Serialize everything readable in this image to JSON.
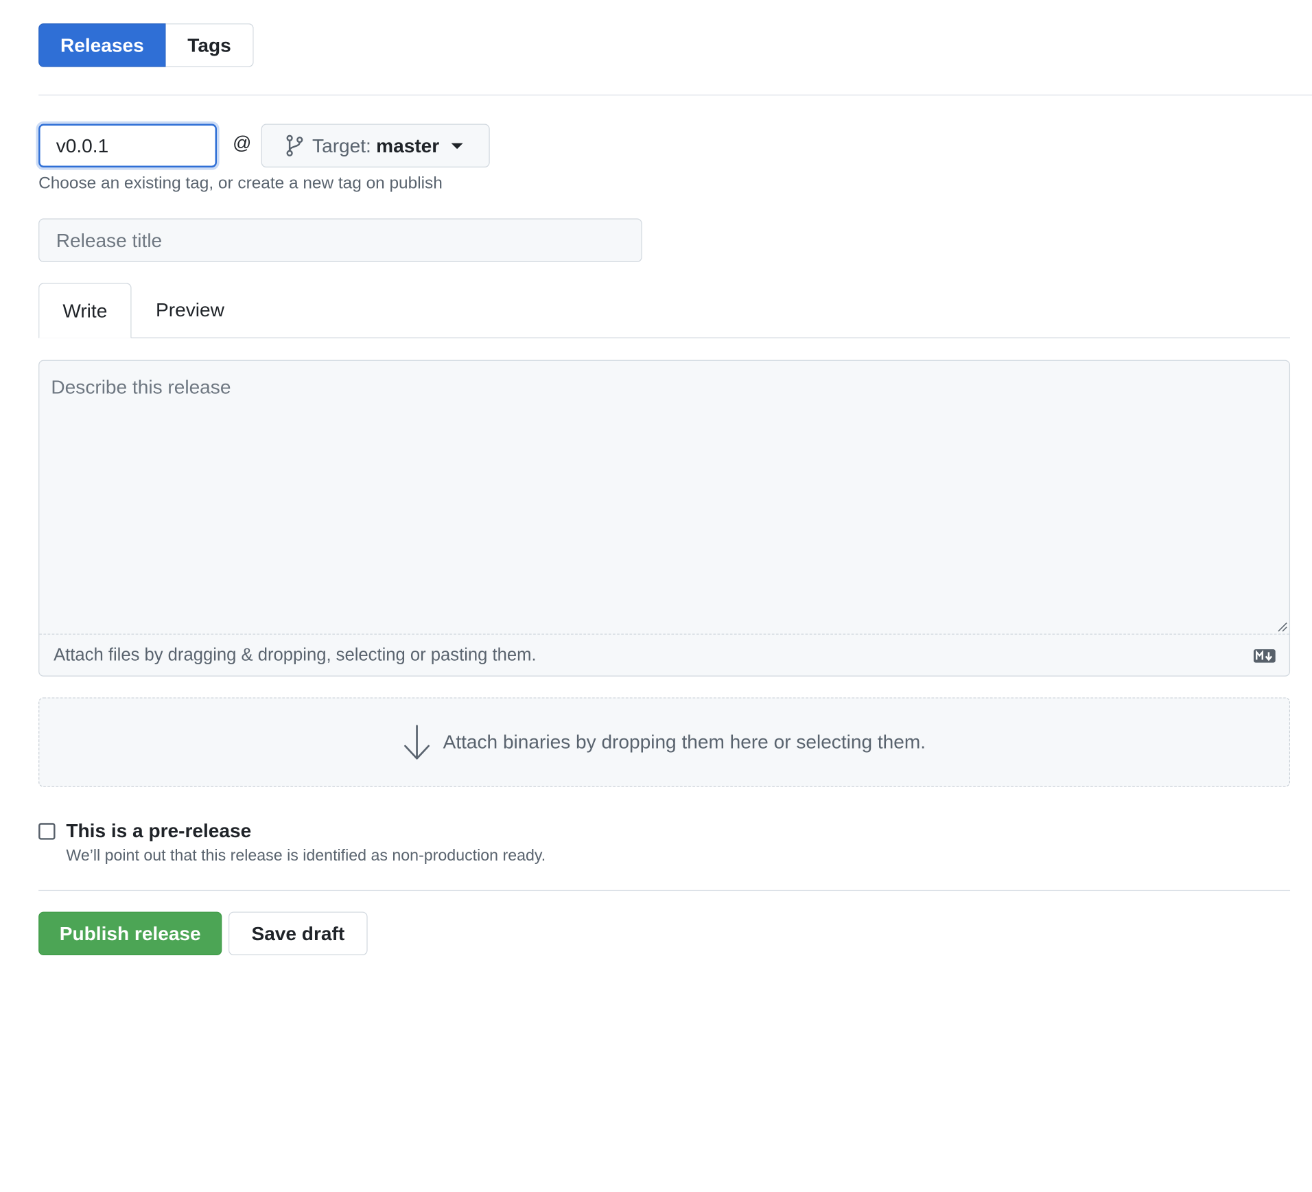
{
  "segmented": {
    "releases_label": "Releases",
    "tags_label": "Tags",
    "active": "Releases"
  },
  "tag": {
    "value": "v0.0.1",
    "at_symbol": "@",
    "target_prefix": "Target:",
    "target_branch": "master",
    "help_text": "Choose an existing tag, or create a new tag on publish"
  },
  "title": {
    "placeholder": "Release title"
  },
  "editor": {
    "tabs": [
      {
        "label": "Write",
        "active": true
      },
      {
        "label": "Preview",
        "active": false
      }
    ],
    "placeholder": "Describe this release",
    "attach_text": "Attach files by dragging & dropping, selecting or pasting them.",
    "markdown_icon": "markdown-icon"
  },
  "binaries": {
    "text": "Attach binaries by dropping them here or selecting them.",
    "icon": "arrow-down-icon"
  },
  "prerelease": {
    "label": "This is a pre-release",
    "help": "We’ll point out that this release is identified as non-production ready.",
    "checked": false
  },
  "actions": {
    "publish_label": "Publish release",
    "draft_label": "Save draft"
  },
  "colors": {
    "primary_blue": "#2f6fd6",
    "publish_green": "#4ca555",
    "muted_text": "#59636e",
    "border": "#d0d7de"
  }
}
